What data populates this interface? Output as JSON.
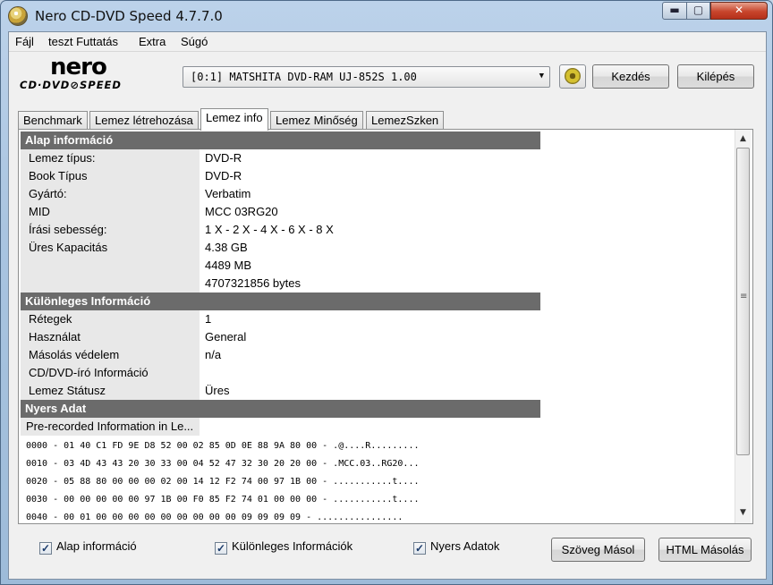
{
  "window": {
    "title": "Nero CD-DVD Speed 4.7.7.0",
    "min_glyph": "▬",
    "max_glyph": "▢",
    "close_glyph": "✕"
  },
  "menu": [
    "Fájl",
    "teszt Futtatás",
    "Extra",
    "Súgó"
  ],
  "logo": {
    "word": "nero",
    "sub": "CD·DVD⊘SPEED"
  },
  "toolbar": {
    "drive": "[0:1]  MATSHITA DVD-RAM UJ-852S 1.00",
    "start_label": "Kezdés",
    "exit_label": "Kilépés"
  },
  "tabs": [
    "Benchmark",
    "Lemez létrehozása",
    "Lemez info",
    "Lemez Minőség",
    "LemezSzken"
  ],
  "active_tab": "Lemez info",
  "sections": {
    "basic": {
      "title": "Alap információ",
      "rows": [
        {
          "label": "Lemez típus:",
          "value": "DVD-R"
        },
        {
          "label": "Book Típus",
          "value": "DVD-R"
        },
        {
          "label": "Gyártó:",
          "value": "Verbatim"
        },
        {
          "label": "MID",
          "value": "MCC 03RG20"
        },
        {
          "label": "Írási sebesség:",
          "value": "1 X - 2 X - 4 X - 6 X - 8 X"
        },
        {
          "label": "Üres Kapacitás",
          "value": "4.38 GB"
        },
        {
          "label": "",
          "value": "4489 MB"
        },
        {
          "label": "",
          "value": "4707321856 bytes"
        }
      ]
    },
    "special": {
      "title": "Különleges Információ",
      "rows": [
        {
          "label": "Rétegek",
          "value": "1"
        },
        {
          "label": "Használat",
          "value": "General"
        },
        {
          "label": "Másolás védelem",
          "value": "n/a"
        },
        {
          "label": "CD/DVD-író Információ",
          "value": ""
        },
        {
          "label": "Lemez Státusz",
          "value": "Üres"
        }
      ]
    },
    "raw": {
      "title": "Nyers Adat",
      "label": "Pre-recorded Information in Le...",
      "lines": [
        "0000 - 01 40 C1 FD 9E D8 52 00 02 85 0D 0E 88 9A 80 00 - .@....R.........",
        "0010 - 03 4D 43 43 20 30 33 00 04 52 47 32 30 20 20 00 - .MCC.03..RG20...",
        "0020 - 05 88 80 00 00 00 02 00 14 12 F2 74 00 97 1B 00 - ...........t....",
        "0030 - 00 00 00 00 00 97 1B 00 F0 85 F2 74 01 00 00 00 - ...........t....",
        "0040 - 00 01 00 00 00 00 00 00 00 00 00 09 09 09 09 - ................"
      ]
    }
  },
  "bottom": {
    "chk_basic": "Alap információ",
    "chk_special": "Különleges Információk",
    "chk_raw": "Nyers Adatok",
    "check_glyph": "✓",
    "copy_text": "Szöveg Másol",
    "copy_html": "HTML Másolás"
  },
  "scrollbar": {
    "up": "▲",
    "down": "▼",
    "grip": "≡"
  }
}
